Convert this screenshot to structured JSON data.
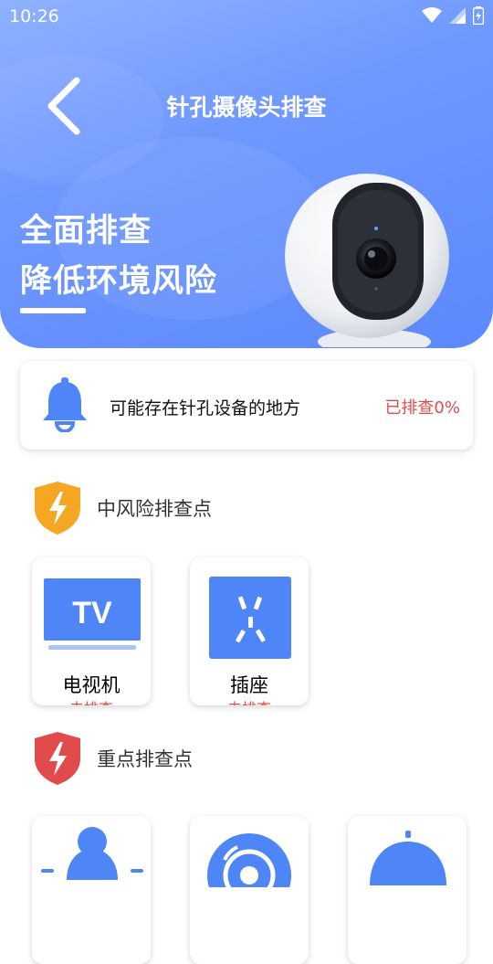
{
  "status_bar": {
    "time": "10:26"
  },
  "header": {
    "title": "针孔摄像头排查"
  },
  "hero": {
    "line1": "全面排查",
    "line2": "降低环境风险"
  },
  "summary_card": {
    "message": "可能存在针孔设备的地方",
    "status": "已排查0%"
  },
  "sections": [
    {
      "title": "中风险排查点",
      "items": [
        {
          "name": "电视机",
          "status": "未排查"
        },
        {
          "name": "插座",
          "status": "未排查"
        }
      ]
    },
    {
      "title": "重点排查点"
    }
  ],
  "colors": {
    "accent": "#4f86f7",
    "warning": "#f5a623",
    "danger": "#e24b4b"
  },
  "icons": [
    "back-arrow-icon",
    "wifi-icon",
    "signal-icon",
    "battery-icon",
    "bell-icon",
    "lightning-shield-icon",
    "tv-icon",
    "socket-icon",
    "smoke-detector-icon",
    "lamp-icon"
  ]
}
